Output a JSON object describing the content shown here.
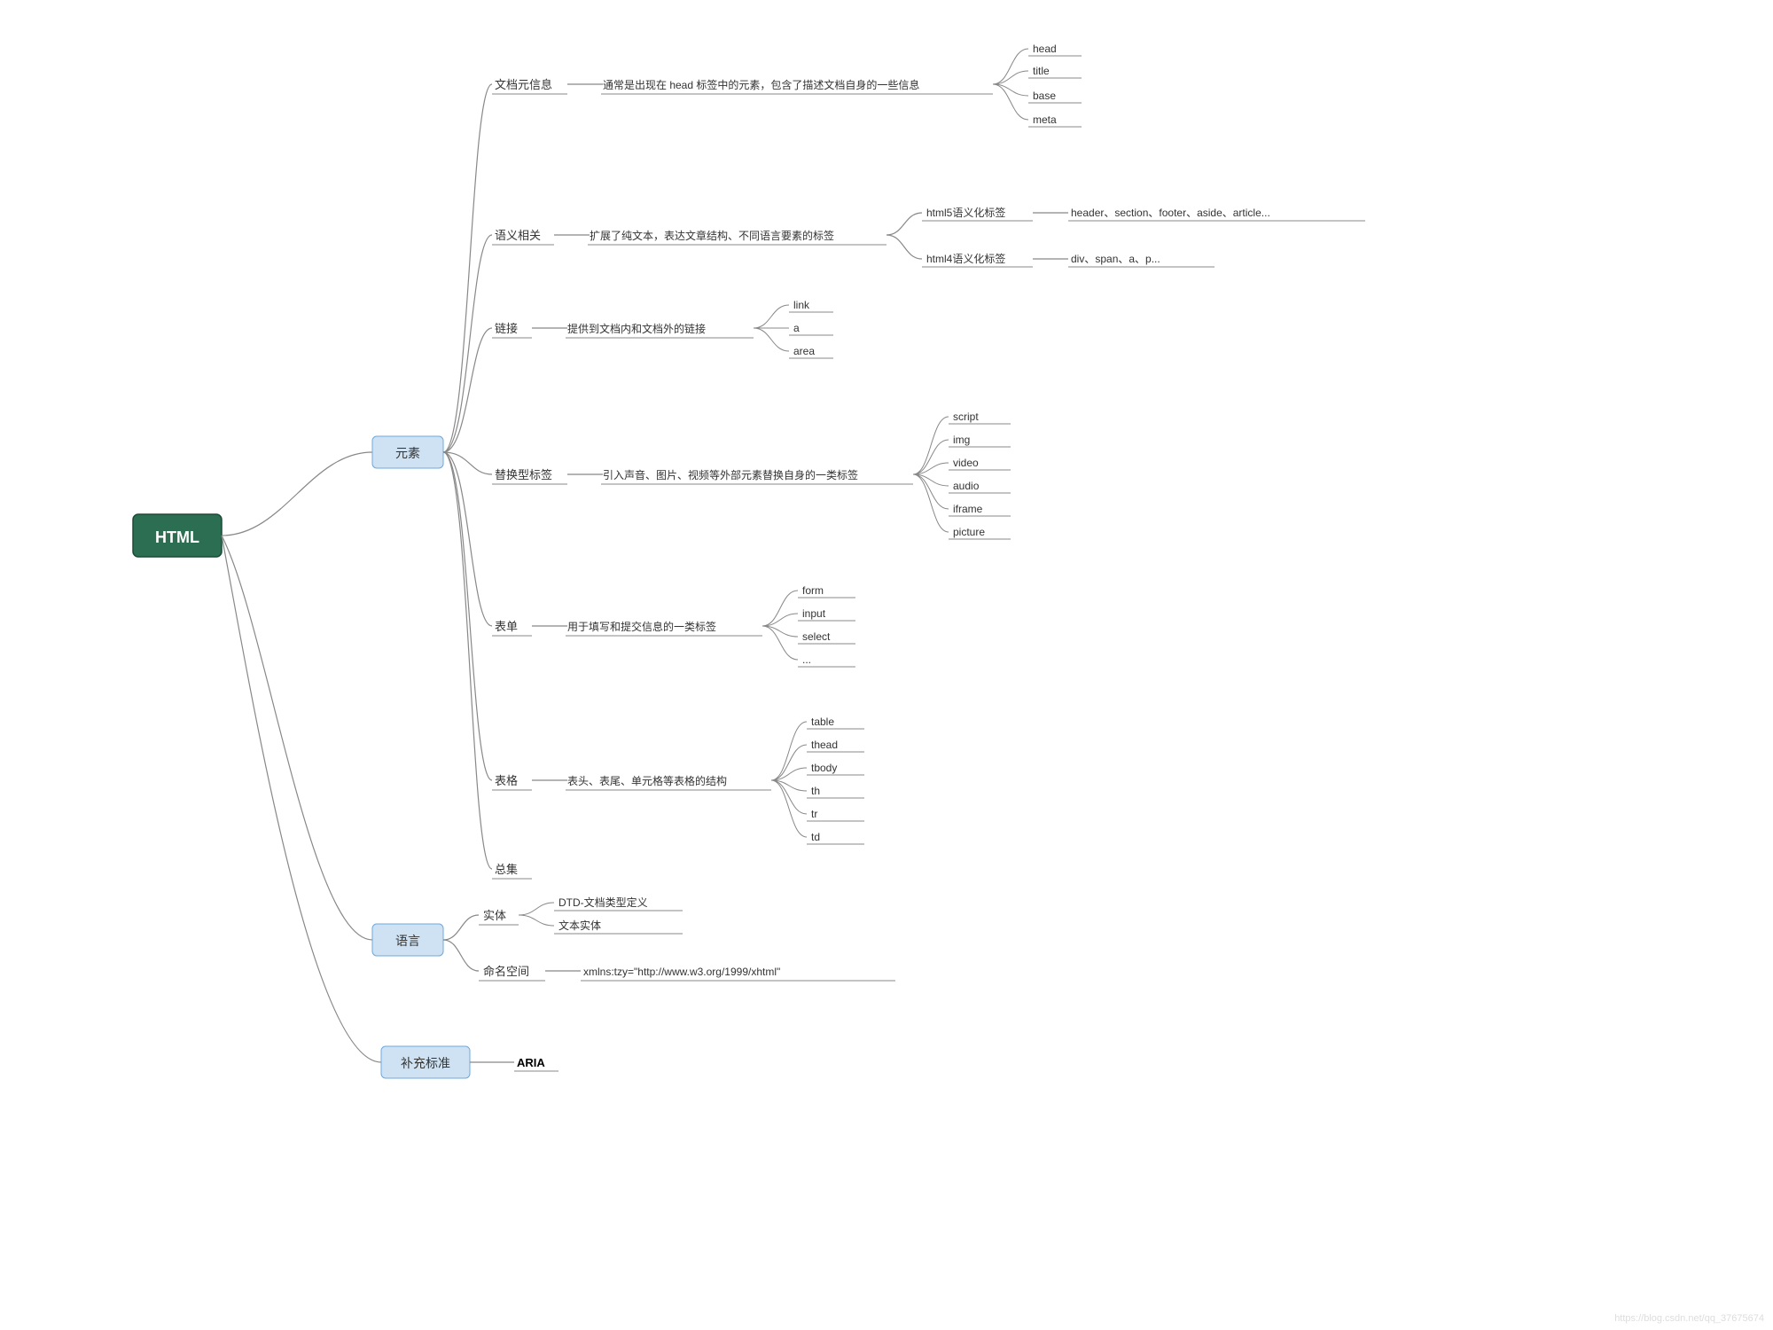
{
  "root": "HTML",
  "groups": {
    "elements": "元素",
    "language": "语言",
    "extra": "补充标准"
  },
  "elements": {
    "docinfo": {
      "label": "文档元信息",
      "desc": "通常是出现在 head 标签中的元素，包含了描述文档自身的一些信息",
      "items": [
        "head",
        "title",
        "base",
        "meta"
      ]
    },
    "semantic": {
      "label": "语义相关",
      "desc": "扩展了纯文本，表达文章结构、不同语言要素的标签",
      "html5": {
        "label": "html5语义化标签",
        "examples": "header、section、footer、aside、article..."
      },
      "html4": {
        "label": "html4语义化标签",
        "examples": "div、span、a、p..."
      }
    },
    "links": {
      "label": "链接",
      "desc": "提供到文档内和文档外的链接",
      "items": [
        "link",
        "a",
        "area"
      ]
    },
    "replaced": {
      "label": "替换型标签",
      "desc": "引入声音、图片、视频等外部元素替换自身的一类标签",
      "items": [
        "script",
        "img",
        "video",
        "audio",
        "iframe",
        "picture"
      ]
    },
    "form": {
      "label": "表单",
      "desc": "用于填写和提交信息的一类标签",
      "items": [
        "form",
        "input",
        "select",
        "..."
      ]
    },
    "table": {
      "label": "表格",
      "desc": "表头、表尾、单元格等表格的结构",
      "items": [
        "table",
        "thead",
        "tbody",
        "th",
        "tr",
        "td"
      ]
    },
    "summary": {
      "label": "总集"
    }
  },
  "language": {
    "entity": {
      "label": "实体",
      "items": [
        "DTD-文档类型定义",
        "文本实体"
      ]
    },
    "namespace": {
      "label": "命名空间",
      "value": "xmlns:tzy=\"http://www.w3.org/1999/xhtml\""
    }
  },
  "extra": {
    "aria": "ARIA"
  },
  "watermark": "https://blog.csdn.net/qq_37675674"
}
